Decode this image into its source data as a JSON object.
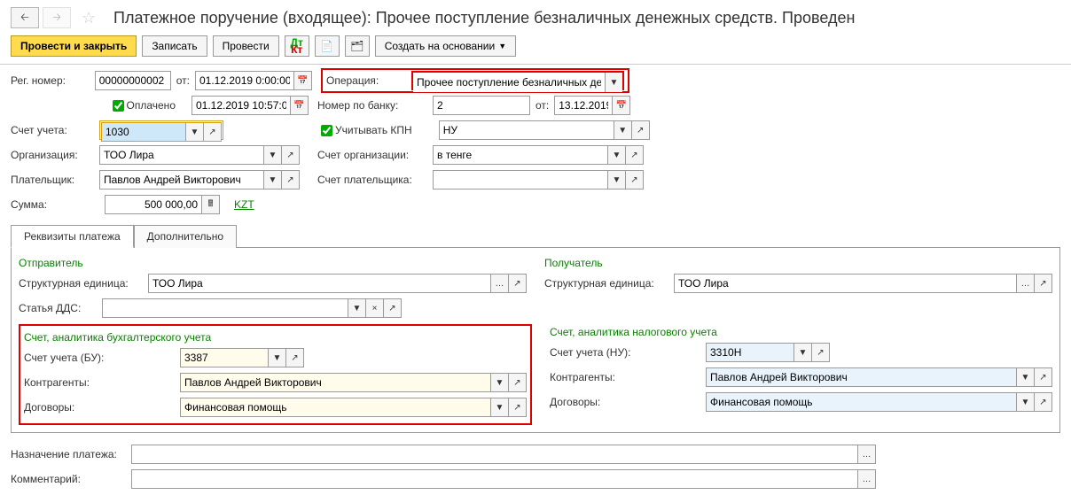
{
  "header": {
    "title": "Платежное поручение (входящее): Прочее поступление безналичных денежных средств. Проведен"
  },
  "toolbar": {
    "post_close": "Провести и закрыть",
    "save": "Записать",
    "post": "Провести",
    "create_based": "Создать на основании"
  },
  "row1": {
    "reg_label": "Рег. номер:",
    "reg_value": "00000000002",
    "from_label": "от:",
    "from_value": "01.12.2019 0:00:00",
    "op_label": "Операция:",
    "op_value": "Прочее поступление безналичных денеж"
  },
  "row2": {
    "paid_label": "Оплачено",
    "paid_date": "01.12.2019 10:57:04",
    "bank_num_label": "Номер по банку:",
    "bank_num_value": "2",
    "bank_from_label": "от:",
    "bank_from_value": "13.12.2019"
  },
  "row3": {
    "account_label": "Счет учета:",
    "account_value": "1030",
    "kpn_label": "Учитывать КПН",
    "kpn_value": "НУ"
  },
  "row4": {
    "org_label": "Организация:",
    "org_value": "ТОО Лира",
    "org_acc_label": "Счет организации:",
    "org_acc_value": "в тенге"
  },
  "row5": {
    "payer_label": "Плательщик:",
    "payer_value": "Павлов Андрей Викторович",
    "payer_acc_label": "Счет плательщика:",
    "payer_acc_value": ""
  },
  "row6": {
    "sum_label": "Сумма:",
    "sum_value": "500 000,00",
    "currency": "KZT"
  },
  "tabs": {
    "tab1": "Реквизиты платежа",
    "tab2": "Дополнительно"
  },
  "details": {
    "sender_title": "Отправитель",
    "recipient_title": "Получатель",
    "struct_unit_label": "Структурная единица:",
    "struct_unit_value": "ТОО Лира",
    "dds_label": "Статья ДДС:",
    "dds_value": "",
    "bu_title": "Счет, аналитика бухгалтерского учета",
    "nu_title": "Счет, аналитика налогового учета",
    "bu_acc_label": "Счет учета (БУ):",
    "bu_acc_value": "3387",
    "nu_acc_label": "Счет учета (НУ):",
    "nu_acc_value": "3310Н",
    "counterparty_label": "Контрагенты:",
    "counterparty_value": "Павлов Андрей Викторович",
    "contract_label": "Договоры:",
    "contract_value": "Финансовая помощь"
  },
  "footer": {
    "purpose_label": "Назначение платежа:",
    "purpose_value": "",
    "comment_label": "Комментарий:",
    "comment_value": ""
  }
}
